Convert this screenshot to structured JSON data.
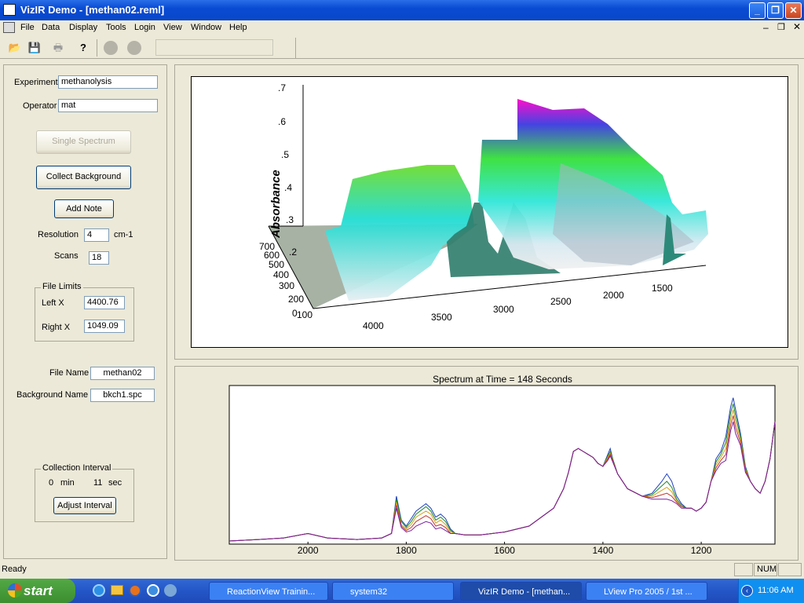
{
  "window": {
    "title": "VizIR Demo - [methan02.reml]"
  },
  "menu": [
    "File",
    "Data",
    "Display",
    "Tools",
    "Login",
    "View",
    "Window",
    "Help"
  ],
  "toolbar": {
    "icons": [
      "open-folder-icon",
      "save-icon",
      "print-icon",
      "help-icon",
      "record-icon",
      "stop-icon"
    ]
  },
  "left": {
    "experiment_label": "Experiment",
    "experiment_value": "methanolysis",
    "operator_label": "Operator",
    "operator_value": "mat",
    "single_spectrum": "Single Spectrum",
    "collect_background": "Collect Background",
    "add_note": "Add Note",
    "resolution_label": "Resolution",
    "resolution_value": "4",
    "resolution_unit": "cm-1",
    "scans_label": "Scans",
    "scans_value": "18",
    "file_limits_title": "File Limits",
    "left_x_label": "Left X",
    "left_x_value": "4400.76",
    "right_x_label": "Right X",
    "right_x_value": "1049.09",
    "file_name_label": "File Name",
    "file_name_value": "methan02",
    "background_name_label": "Background Name",
    "background_name_value": "bkch1.spc",
    "collection_interval_title": "Collection Interval",
    "interval_min": "0",
    "min_unit": "min",
    "interval_sec": "11",
    "sec_unit": "sec",
    "adjust_interval": "Adjust Interval"
  },
  "plot3d": {
    "y_axis_label": "Absorbance",
    "y_ticks": [
      ".7",
      ".6",
      ".5",
      ".4",
      ".3",
      ".2"
    ],
    "time_ticks": [
      "700",
      "600",
      "500",
      "400",
      "300",
      "200",
      "100",
      "0"
    ],
    "x_ticks": [
      "4000",
      "3500",
      "3000",
      "2500",
      "2000",
      "1500"
    ]
  },
  "chart_data": {
    "type": "line",
    "title": "Spectrum at Time =  148 Seconds",
    "xlabel": "",
    "ylabel": "",
    "x_ticks": [
      "2000",
      "1800",
      "1600",
      "1400",
      "1200"
    ],
    "xlim": [
      2160,
      1050
    ],
    "x": [
      2160,
      2100,
      2050,
      2000,
      1960,
      1900,
      1850,
      1830,
      1820,
      1810,
      1800,
      1790,
      1780,
      1760,
      1750,
      1740,
      1730,
      1720,
      1710,
      1700,
      1680,
      1650,
      1600,
      1550,
      1500,
      1480,
      1470,
      1460,
      1450,
      1440,
      1430,
      1420,
      1410,
      1400,
      1390,
      1385,
      1380,
      1370,
      1350,
      1320,
      1300,
      1280,
      1270,
      1260,
      1250,
      1240,
      1230,
      1220,
      1210,
      1200,
      1190,
      1180,
      1170,
      1160,
      1150,
      1140,
      1135,
      1130,
      1120,
      1110,
      1100,
      1090,
      1080,
      1070,
      1060,
      1050
    ],
    "series": [
      {
        "values": [
          0.0,
          0.01,
          0.02,
          0.05,
          0.02,
          0.01,
          0.02,
          0.05,
          0.3,
          0.14,
          0.1,
          0.15,
          0.2,
          0.25,
          0.22,
          0.16,
          0.18,
          0.15,
          0.08,
          0.05,
          0.04,
          0.04,
          0.06,
          0.1,
          0.22,
          0.35,
          0.46,
          0.6,
          0.62,
          0.6,
          0.58,
          0.56,
          0.52,
          0.5,
          0.58,
          0.62,
          0.55,
          0.45,
          0.35,
          0.3,
          0.32,
          0.4,
          0.45,
          0.4,
          0.3,
          0.25,
          0.22,
          0.22,
          0.2,
          0.22,
          0.26,
          0.4,
          0.55,
          0.6,
          0.7,
          0.9,
          0.96,
          0.88,
          0.72,
          0.5,
          0.4,
          0.35,
          0.32,
          0.4,
          0.55,
          0.8
        ]
      },
      {
        "values": [
          0.0,
          0.01,
          0.02,
          0.05,
          0.02,
          0.01,
          0.02,
          0.05,
          0.28,
          0.13,
          0.09,
          0.13,
          0.18,
          0.23,
          0.2,
          0.14,
          0.16,
          0.13,
          0.07,
          0.05,
          0.04,
          0.04,
          0.06,
          0.1,
          0.22,
          0.35,
          0.46,
          0.6,
          0.62,
          0.6,
          0.58,
          0.56,
          0.52,
          0.5,
          0.57,
          0.6,
          0.55,
          0.45,
          0.35,
          0.3,
          0.31,
          0.37,
          0.4,
          0.36,
          0.28,
          0.24,
          0.22,
          0.22,
          0.2,
          0.22,
          0.26,
          0.4,
          0.53,
          0.58,
          0.66,
          0.86,
          0.92,
          0.84,
          0.7,
          0.49,
          0.4,
          0.35,
          0.32,
          0.4,
          0.55,
          0.8
        ]
      },
      {
        "values": [
          0.0,
          0.01,
          0.02,
          0.05,
          0.02,
          0.01,
          0.02,
          0.05,
          0.26,
          0.11,
          0.08,
          0.11,
          0.16,
          0.2,
          0.18,
          0.12,
          0.14,
          0.11,
          0.06,
          0.05,
          0.04,
          0.04,
          0.06,
          0.1,
          0.22,
          0.35,
          0.46,
          0.6,
          0.62,
          0.6,
          0.58,
          0.56,
          0.52,
          0.5,
          0.56,
          0.59,
          0.54,
          0.45,
          0.35,
          0.3,
          0.3,
          0.34,
          0.36,
          0.33,
          0.27,
          0.23,
          0.22,
          0.22,
          0.2,
          0.22,
          0.26,
          0.4,
          0.51,
          0.56,
          0.62,
          0.82,
          0.88,
          0.8,
          0.68,
          0.48,
          0.4,
          0.35,
          0.32,
          0.4,
          0.55,
          0.8
        ]
      },
      {
        "values": [
          0.0,
          0.01,
          0.02,
          0.05,
          0.02,
          0.01,
          0.02,
          0.05,
          0.24,
          0.1,
          0.07,
          0.09,
          0.13,
          0.17,
          0.15,
          0.1,
          0.11,
          0.09,
          0.05,
          0.05,
          0.04,
          0.04,
          0.06,
          0.1,
          0.22,
          0.35,
          0.46,
          0.6,
          0.62,
          0.6,
          0.58,
          0.56,
          0.52,
          0.5,
          0.55,
          0.58,
          0.54,
          0.45,
          0.35,
          0.3,
          0.29,
          0.31,
          0.32,
          0.3,
          0.26,
          0.23,
          0.22,
          0.22,
          0.2,
          0.22,
          0.26,
          0.4,
          0.49,
          0.54,
          0.58,
          0.78,
          0.84,
          0.76,
          0.66,
          0.47,
          0.4,
          0.35,
          0.32,
          0.4,
          0.55,
          0.8
        ]
      },
      {
        "values": [
          0.0,
          0.01,
          0.02,
          0.05,
          0.02,
          0.01,
          0.02,
          0.05,
          0.22,
          0.09,
          0.06,
          0.07,
          0.1,
          0.13,
          0.12,
          0.08,
          0.09,
          0.07,
          0.05,
          0.05,
          0.04,
          0.04,
          0.06,
          0.1,
          0.22,
          0.35,
          0.46,
          0.6,
          0.62,
          0.6,
          0.58,
          0.56,
          0.52,
          0.5,
          0.54,
          0.57,
          0.53,
          0.45,
          0.35,
          0.3,
          0.28,
          0.28,
          0.28,
          0.27,
          0.25,
          0.22,
          0.22,
          0.22,
          0.2,
          0.22,
          0.26,
          0.4,
          0.47,
          0.52,
          0.54,
          0.74,
          0.8,
          0.72,
          0.64,
          0.46,
          0.4,
          0.35,
          0.32,
          0.4,
          0.55,
          0.8
        ]
      }
    ],
    "colors": [
      "#1f3fbf",
      "#1a8a2a",
      "#d4a017",
      "#c0392b",
      "#7b1fa2"
    ]
  }
}
